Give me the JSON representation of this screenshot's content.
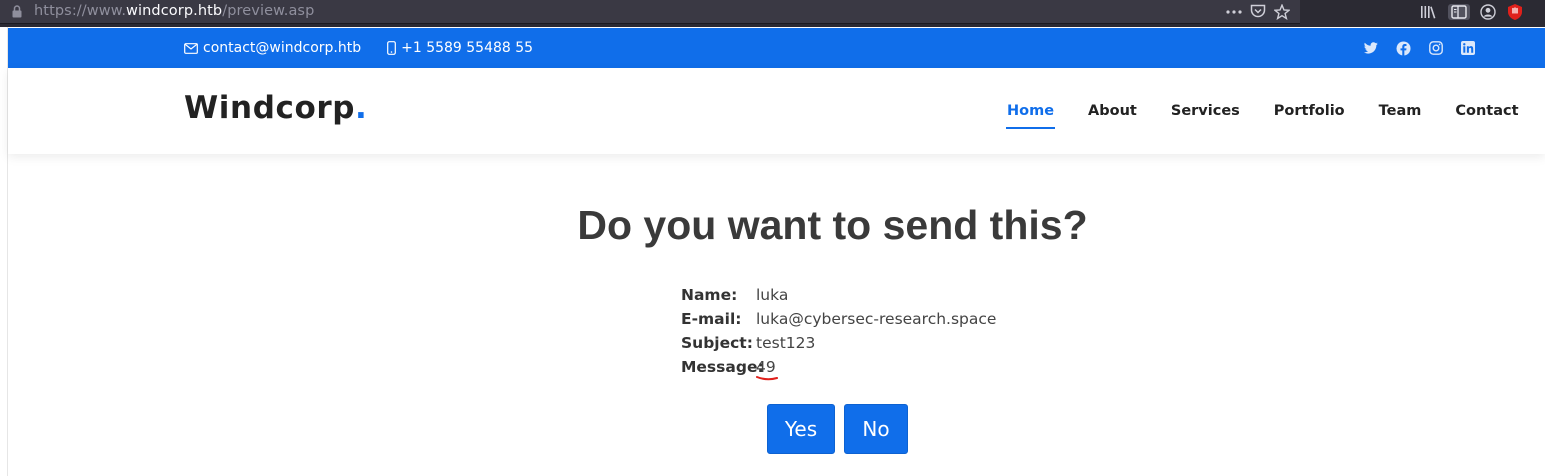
{
  "browser": {
    "url_prefix": "https://www.",
    "url_domain": "windcorp.htb",
    "url_path": "/preview.asp"
  },
  "topbar": {
    "email": "contact@windcorp.htb",
    "phone": "+1 5589 55488 55",
    "social": [
      "twitter-icon",
      "facebook-icon",
      "instagram-icon",
      "linkedin-icon"
    ]
  },
  "header": {
    "logo": "Windcorp",
    "logo_dot": ".",
    "nav": [
      "Home",
      "About",
      "Services",
      "Portfolio",
      "Team",
      "Contact"
    ],
    "active_nav": "Home"
  },
  "main": {
    "heading": "Do you want to send this?",
    "fields": [
      {
        "label": "Name:",
        "value": "luka"
      },
      {
        "label": "E-mail:",
        "value": "luka@cybersec-research.space"
      },
      {
        "label": "Subject:",
        "value": "test123"
      },
      {
        "label": "Message:",
        "value": "49"
      }
    ],
    "yes_label": "Yes",
    "no_label": "No"
  },
  "colors": {
    "brand": "#106eea",
    "annotation": "#e0201b"
  }
}
